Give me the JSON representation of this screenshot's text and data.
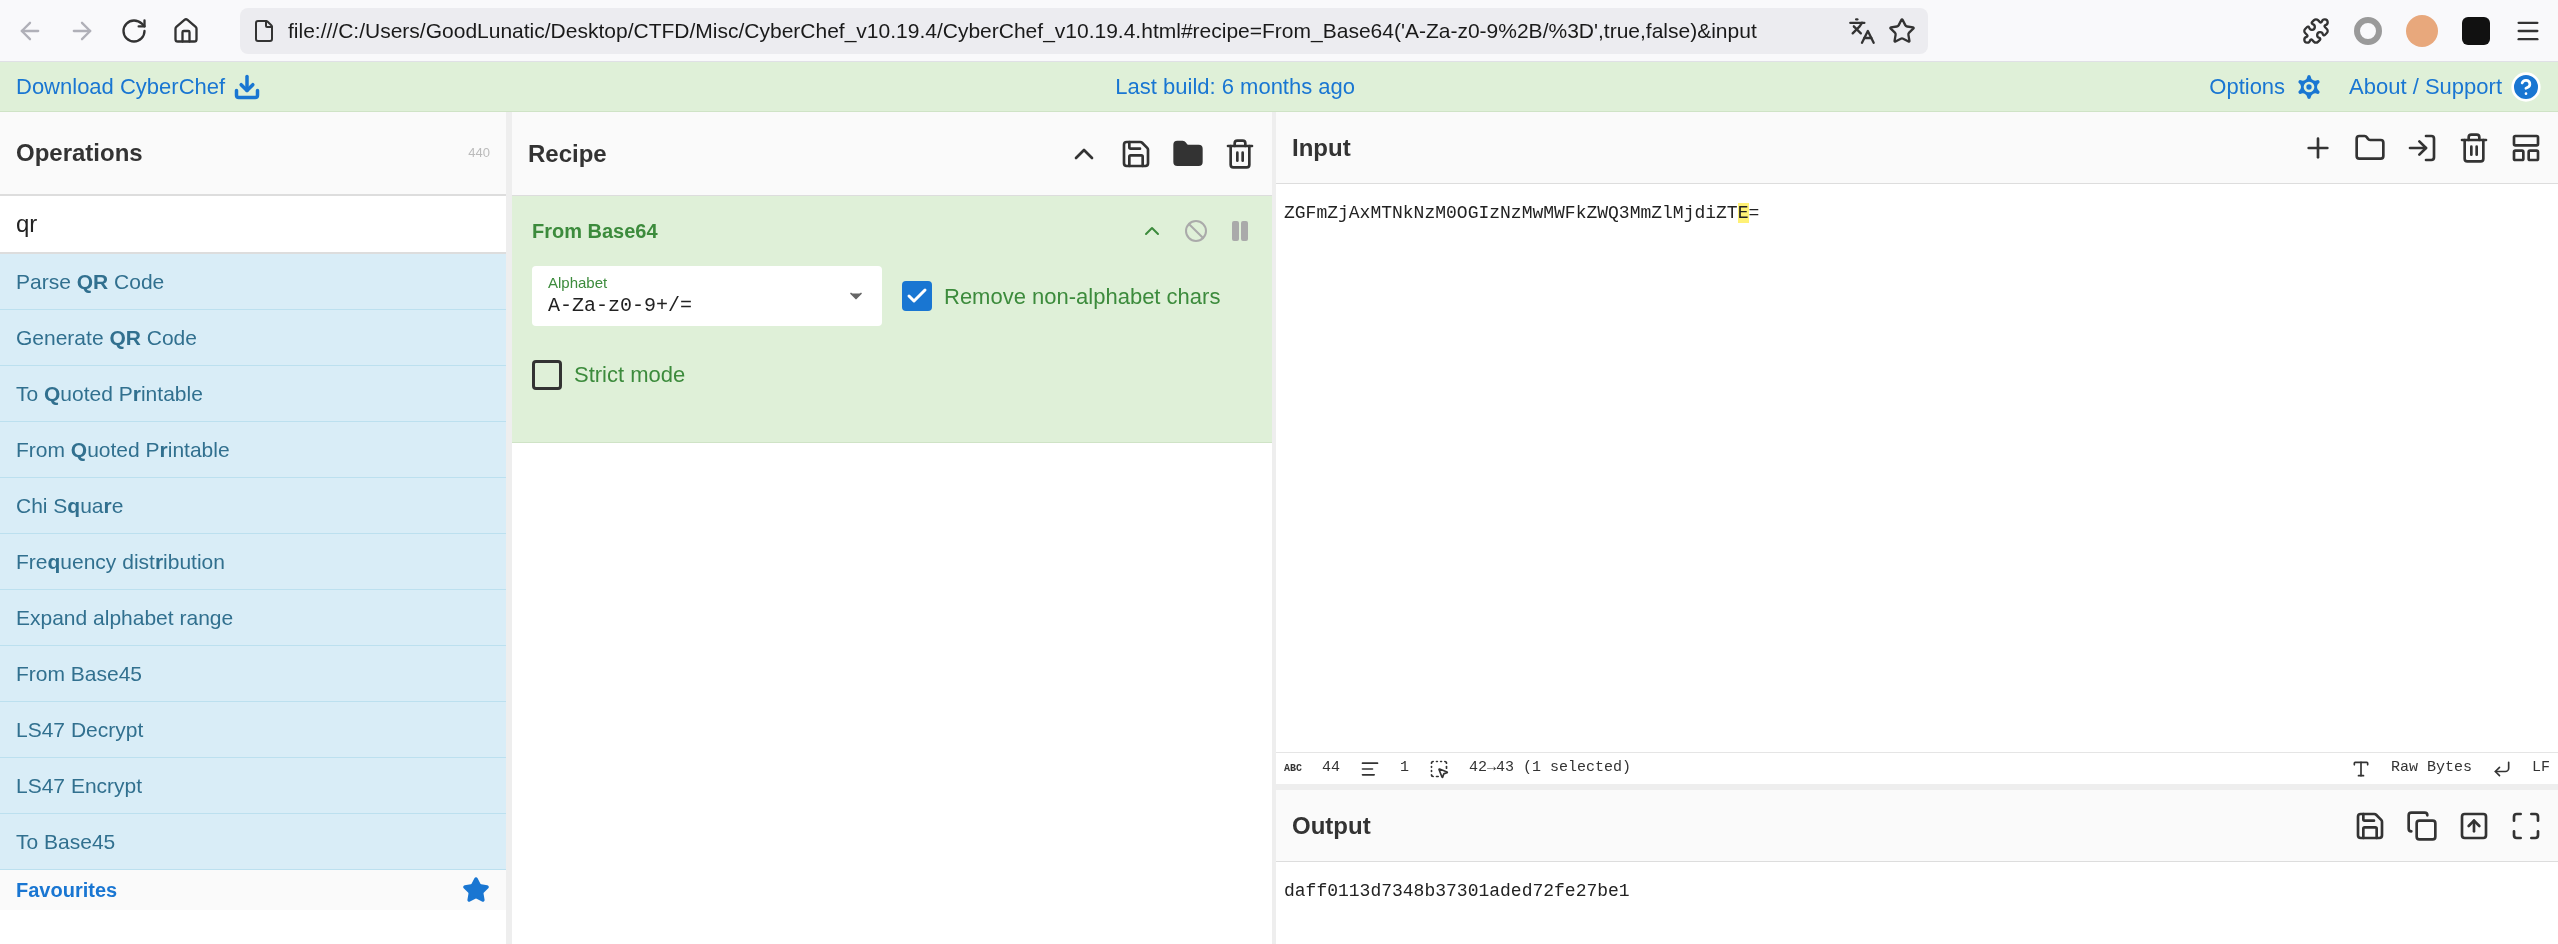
{
  "browser": {
    "url": "file:///C:/Users/GoodLunatic/Desktop/CTFD/Misc/CyberChef_v10.19.4/CyberChef_v10.19.4.html#recipe=From_Base64('A-Za-z0-9%2B/%3D',true,false)&input"
  },
  "banner": {
    "download": "Download CyberChef",
    "last_build": "Last build: 6 months ago",
    "options": "Options",
    "about": "About / Support"
  },
  "operations": {
    "title": "Operations",
    "count": "440",
    "search": "qr",
    "items": [
      {
        "label": "Parse **QR** Code"
      },
      {
        "label": "Generate **QR** Code"
      },
      {
        "label": "To **Q**uoted P**r**intable"
      },
      {
        "label": "From **Q**uoted P**r**intable"
      },
      {
        "label": "Chi S**q**ua**r**e"
      },
      {
        "label": "Fre**q**uency dist**r**ibution"
      },
      {
        "label": "Expand alphabet range"
      },
      {
        "label": "From Base45"
      },
      {
        "label": "LS47 Decrypt"
      },
      {
        "label": "LS47 Encrypt"
      },
      {
        "label": "To Base45"
      }
    ],
    "favourites": "Favourites"
  },
  "recipe": {
    "title": "Recipe",
    "operation": {
      "name": "From Base64",
      "alphabet": {
        "label": "Alphabet",
        "value": "A-Za-z0-9+/="
      },
      "options": [
        {
          "label": "Remove non-alphabet chars",
          "checked": true
        },
        {
          "label": "Strict mode",
          "checked": false
        }
      ]
    }
  },
  "input": {
    "title": "Input",
    "text_before": "ZGFmZjAxMTNkNzM0OGIzNzMwMWFkZWQ3MmZlMjdiZT",
    "text_selected": "E",
    "text_after": "=",
    "status": {
      "abc": "ABC",
      "length": "44",
      "lines": "1",
      "selection": "42→43 (1 selected)",
      "encoding": "Raw Bytes",
      "eol": "LF"
    }
  },
  "output": {
    "title": "Output",
    "text": "daff0113d7348b37301aded72fe27be1"
  }
}
